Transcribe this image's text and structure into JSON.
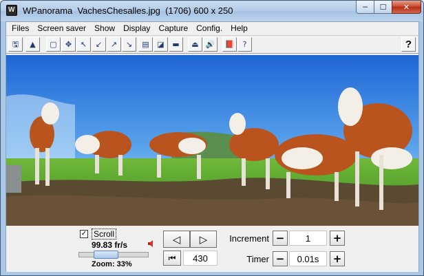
{
  "window": {
    "title": "WPanorama  VachesChesalles.jpg  (1706) 600 x 250",
    "min_glyph": "─",
    "max_glyph": "☐",
    "close_glyph": "✕"
  },
  "menu": [
    "Files",
    "Screen saver",
    "Show",
    "Display",
    "Capture",
    "Config.",
    "Help"
  ],
  "toolbar": {
    "buttons": [
      {
        "icon": "open-folder-icon",
        "glyph": "🖫"
      },
      {
        "icon": "image-icon",
        "glyph": "▲"
      },
      {
        "icon": "fit-window-icon",
        "glyph": "▢"
      },
      {
        "icon": "move-icon",
        "glyph": "✥"
      },
      {
        "icon": "arrow-up-left-icon",
        "glyph": "↖"
      },
      {
        "icon": "arrow-down-left-icon",
        "glyph": "↙"
      },
      {
        "icon": "arrow-up-right-icon",
        "glyph": "↗"
      },
      {
        "icon": "arrow-down-right-icon",
        "glyph": "↘"
      },
      {
        "icon": "panorama-top-icon",
        "glyph": "▤"
      },
      {
        "icon": "panorama-landscape-icon",
        "glyph": "◪"
      },
      {
        "icon": "panorama-strip-icon",
        "glyph": "▬"
      },
      {
        "icon": "tripod-icon",
        "glyph": "⏏"
      },
      {
        "icon": "sound-icon",
        "glyph": "🔊"
      },
      {
        "icon": "book-icon",
        "glyph": "📕"
      },
      {
        "icon": "help-book-icon",
        "glyph": "?"
      }
    ],
    "help_label": "?"
  },
  "controls": {
    "scroll_checked": "✓",
    "scroll_label": "Scroll",
    "fps": "99.83 fr/s",
    "zoom": "Zoom: 33%",
    "zoom_fraction": 0.33,
    "prev_glyph": "◁",
    "next_glyph": "▷",
    "first_glyph": "⏮",
    "position": "430",
    "increment_label": "Increment",
    "increment_value": "1",
    "timer_label": "Timer",
    "timer_value": "0.01s",
    "minus": "−",
    "plus": "+"
  }
}
